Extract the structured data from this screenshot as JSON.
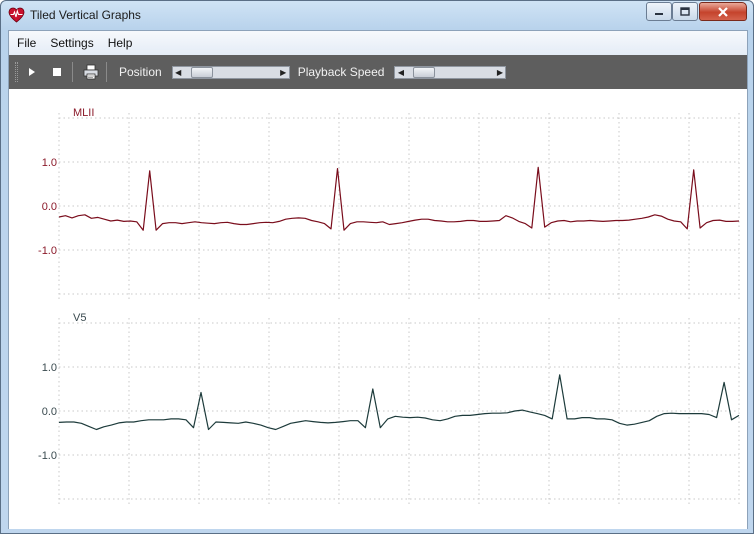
{
  "window": {
    "title": "Tiled Vertical Graphs",
    "minimize_icon": "minimize-icon",
    "maximize_icon": "maximize-icon",
    "close_icon": "close-icon"
  },
  "menu": [
    {
      "label": "File"
    },
    {
      "label": "Settings"
    },
    {
      "label": "Help"
    }
  ],
  "toolbar": {
    "play_icon": "play-icon",
    "stop_icon": "stop-icon",
    "print_icon": "print-icon",
    "position_label": "Position",
    "position_value": 0.1,
    "playback_label": "Playback Speed",
    "playback_value": 0.1
  },
  "colors": {
    "mlii_trace": "#7a0d1c",
    "mlii_axis_text": "#8b1a2a",
    "v5_trace": "#1d3b3b",
    "v5_axis_text": "#3a4a4f",
    "grid": "#c8c8c8"
  },
  "chart_data": [
    {
      "type": "line",
      "title": "MLII",
      "yticks": [
        "1.0",
        "0.0",
        "-1.0"
      ],
      "ylim": [
        -2,
        2
      ],
      "series": [
        {
          "name": "MLII",
          "values": [
            -0.25,
            -0.22,
            -0.27,
            -0.22,
            -0.2,
            -0.28,
            -0.26,
            -0.3,
            -0.34,
            -0.32,
            -0.35,
            -0.34,
            -0.36,
            -0.55,
            0.8,
            -0.55,
            -0.4,
            -0.38,
            -0.38,
            -0.4,
            -0.38,
            -0.36,
            -0.38,
            -0.39,
            -0.4,
            -0.38,
            -0.37,
            -0.4,
            -0.42,
            -0.42,
            -0.4,
            -0.38,
            -0.37,
            -0.38,
            -0.35,
            -0.3,
            -0.28,
            -0.27,
            -0.28,
            -0.33,
            -0.36,
            -0.4,
            -0.52,
            0.85,
            -0.55,
            -0.4,
            -0.36,
            -0.36,
            -0.37,
            -0.38,
            -0.36,
            -0.42,
            -0.4,
            -0.38,
            -0.35,
            -0.32,
            -0.3,
            -0.3,
            -0.33,
            -0.34,
            -0.36,
            -0.36,
            -0.35,
            -0.33,
            -0.33,
            -0.35,
            -0.35,
            -0.34,
            -0.33,
            -0.22,
            -0.27,
            -0.35,
            -0.4,
            -0.5,
            0.88,
            -0.48,
            -0.38,
            -0.34,
            -0.33,
            -0.36,
            -0.34,
            -0.34,
            -0.33,
            -0.34,
            -0.35,
            -0.34,
            -0.33,
            -0.33,
            -0.32,
            -0.3,
            -0.28,
            -0.25,
            -0.2,
            -0.23,
            -0.3,
            -0.34,
            -0.36,
            -0.52,
            0.82,
            -0.5,
            -0.38,
            -0.33,
            -0.32,
            -0.35,
            -0.35,
            -0.34
          ]
        }
      ]
    },
    {
      "type": "line",
      "title": "V5",
      "yticks": [
        "1.0",
        "0.0",
        "-1.0"
      ],
      "ylim": [
        -2,
        2
      ],
      "series": [
        {
          "name": "V5",
          "values": [
            -0.26,
            -0.25,
            -0.25,
            -0.28,
            -0.35,
            -0.42,
            -0.36,
            -0.32,
            -0.27,
            -0.25,
            -0.25,
            -0.22,
            -0.2,
            -0.2,
            -0.2,
            -0.18,
            -0.18,
            -0.2,
            -0.38,
            0.42,
            -0.42,
            -0.25,
            -0.26,
            -0.27,
            -0.28,
            -0.25,
            -0.28,
            -0.32,
            -0.38,
            -0.42,
            -0.35,
            -0.28,
            -0.25,
            -0.22,
            -0.24,
            -0.26,
            -0.27,
            -0.26,
            -0.24,
            -0.22,
            -0.22,
            -0.38,
            0.5,
            -0.38,
            -0.18,
            -0.12,
            -0.14,
            -0.15,
            -0.14,
            -0.16,
            -0.2,
            -0.22,
            -0.18,
            -0.12,
            -0.1,
            -0.1,
            -0.08,
            -0.06,
            -0.05,
            -0.05,
            -0.04,
            0.0,
            0.02,
            -0.02,
            -0.06,
            -0.1,
            -0.18,
            0.82,
            -0.18,
            -0.18,
            -0.15,
            -0.15,
            -0.18,
            -0.18,
            -0.2,
            -0.28,
            -0.32,
            -0.3,
            -0.26,
            -0.22,
            -0.12,
            -0.06,
            -0.05,
            -0.06,
            -0.06,
            -0.06,
            -0.06,
            -0.08,
            -0.15,
            0.65,
            -0.2,
            -0.1
          ]
        }
      ]
    }
  ]
}
